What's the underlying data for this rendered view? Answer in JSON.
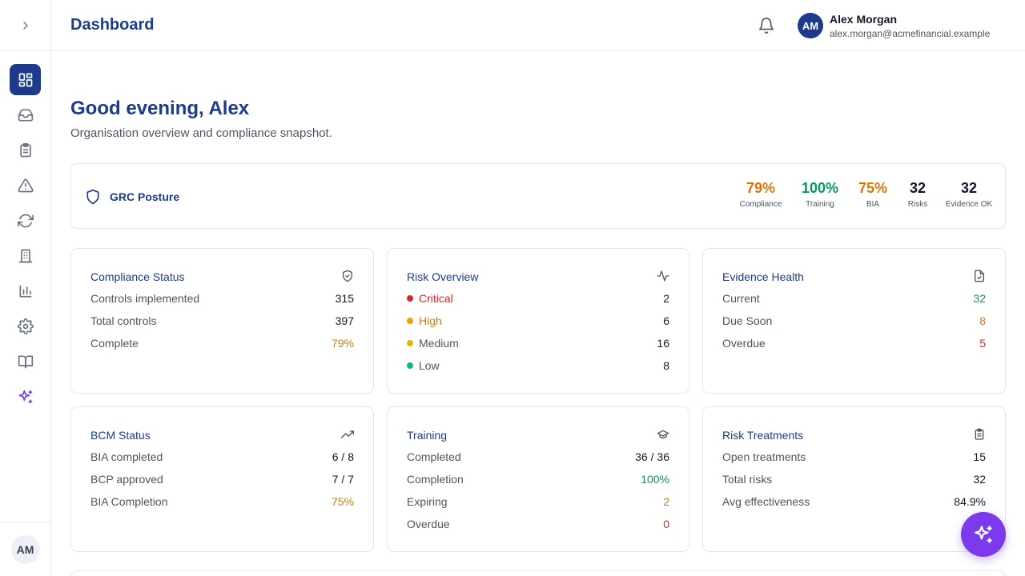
{
  "header": {
    "title": "Dashboard",
    "user": {
      "initials": "AM",
      "name": "Alex Morgan",
      "email": "alex.morgan@acmefinancial.example"
    }
  },
  "sidebar": {
    "items": [
      {
        "icon": "dashboard-icon",
        "active": true
      },
      {
        "icon": "inbox-icon"
      },
      {
        "icon": "clipboard-list-icon"
      },
      {
        "icon": "alert-triangle-icon"
      },
      {
        "icon": "refresh-icon"
      },
      {
        "icon": "building-icon"
      },
      {
        "icon": "bar-chart-icon"
      },
      {
        "icon": "settings-icon"
      },
      {
        "icon": "book-icon"
      },
      {
        "icon": "sparkles-icon"
      }
    ],
    "user_initials": "AM"
  },
  "greeting": {
    "title": "Good evening, Alex",
    "subtitle": "Organisation overview and compliance snapshot."
  },
  "posture": {
    "title": "GRC Posture",
    "metrics": [
      {
        "value": "79%",
        "label": "Compliance",
        "color": "#d97706"
      },
      {
        "value": "100%",
        "label": "Training",
        "color": "#059669"
      },
      {
        "value": "75%",
        "label": "BIA",
        "color": "#d97706"
      },
      {
        "value": "32",
        "label": "Risks",
        "color": "#111827"
      },
      {
        "value": "32",
        "label": "Evidence OK",
        "color": "#111827"
      }
    ]
  },
  "cards": {
    "compliance": {
      "title": "Compliance Status",
      "rows": [
        {
          "label": "Controls implemented",
          "value": "315"
        },
        {
          "label": "Total controls",
          "value": "397"
        },
        {
          "label": "Complete",
          "value": "79%"
        }
      ]
    },
    "risk": {
      "title": "Risk Overview",
      "rows": [
        {
          "label": "Critical",
          "value": "2",
          "color": "#dc2626"
        },
        {
          "label": "High",
          "value": "6",
          "color": "#d97706"
        },
        {
          "label": "Medium",
          "value": "16",
          "color": "#eab308"
        },
        {
          "label": "Low",
          "value": "8",
          "color": "#10b981"
        }
      ]
    },
    "evidence": {
      "title": "Evidence Health",
      "rows": [
        {
          "label": "Current",
          "value": "32"
        },
        {
          "label": "Due Soon",
          "value": "8"
        },
        {
          "label": "Overdue",
          "value": "5"
        }
      ]
    },
    "bcm": {
      "title": "BCM Status",
      "rows": [
        {
          "label": "BIA completed",
          "value": "6 / 8"
        },
        {
          "label": "BCP approved",
          "value": "7 / 7"
        },
        {
          "label": "BIA Completion",
          "value": "75%"
        }
      ]
    },
    "training": {
      "title": "Training",
      "rows": [
        {
          "label": "Completed",
          "value": "36 / 36"
        },
        {
          "label": "Completion",
          "value": "100%"
        },
        {
          "label": "Expiring",
          "value": "2"
        },
        {
          "label": "Overdue",
          "value": "0"
        }
      ]
    },
    "treatments": {
      "title": "Risk Treatments",
      "rows": [
        {
          "label": "Open treatments",
          "value": "15"
        },
        {
          "label": "Total risks",
          "value": "32"
        },
        {
          "label": "Avg effectiveness",
          "value": "84.9%"
        }
      ]
    }
  }
}
